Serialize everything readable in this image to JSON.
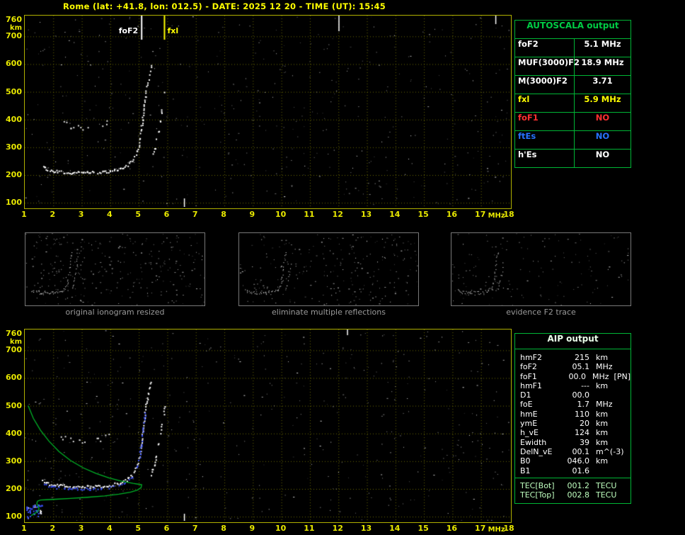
{
  "header": {
    "title": "Rome (lat: +41.8, lon: 012.5) - DATE: 2025 12 20 - TIME (UT): 15:45"
  },
  "axes": {
    "y_unit": "km",
    "x_unit": "MHz",
    "y_ticks": [
      "760",
      "700",
      "600",
      "500",
      "400",
      "300",
      "200",
      "100"
    ],
    "x_ticks": [
      "1",
      "2",
      "3",
      "4",
      "5",
      "6",
      "7",
      "8",
      "9",
      "10",
      "11",
      "12",
      "13",
      "14",
      "15",
      "16",
      "17",
      "18"
    ],
    "y_range_km": [
      100,
      760
    ],
    "x_range_mhz": [
      1,
      18
    ]
  },
  "top_plot": {
    "markers": [
      {
        "label": "foF2",
        "mhz": 5.1,
        "color": "#ffffff",
        "side": "left"
      },
      {
        "label": "fxl",
        "mhz": 5.9,
        "color": "#ffff00",
        "side": "right"
      }
    ]
  },
  "thumbnails": [
    {
      "caption": "original ionogram resized"
    },
    {
      "caption": "eliminate multiple reflections"
    },
    {
      "caption": "evidence F2 trace"
    }
  ],
  "autoscala_table": {
    "title": "AUTOSCALA output",
    "rows": [
      {
        "label": "foF2",
        "value": "5.1 MHz",
        "color": "#ffffff"
      },
      {
        "label": "MUF(3000)F2",
        "value": "18.9 MHz",
        "color": "#ffffff"
      },
      {
        "label": "M(3000)F2",
        "value": "3.71",
        "color": "#ffffff"
      },
      {
        "label": "fxl",
        "value": "5.9 MHz",
        "color": "#ffff00"
      },
      {
        "label": "foF1",
        "value": "NO",
        "color": "#ff3030"
      },
      {
        "label": "ftEs",
        "value": "NO",
        "color": "#2673ff"
      },
      {
        "label": "h'Es",
        "value": "NO",
        "color": "#ffffff"
      }
    ]
  },
  "aip_table": {
    "title": "AIP output",
    "rows": [
      {
        "label": "hmF2",
        "value": "215",
        "unit": "km",
        "note": ""
      },
      {
        "label": "foF2",
        "value": "05.1",
        "unit": "MHz",
        "note": ""
      },
      {
        "label": "foF1",
        "value": "00.0",
        "unit": "MHz",
        "note": "[PN]"
      },
      {
        "label": "hmF1",
        "value": "---",
        "unit": "km",
        "note": ""
      },
      {
        "label": "D1",
        "value": "00.0",
        "unit": "",
        "note": ""
      },
      {
        "label": "foE",
        "value": "1.7",
        "unit": "MHz",
        "note": ""
      },
      {
        "label": "hmE",
        "value": "110",
        "unit": "km",
        "note": ""
      },
      {
        "label": "ymE",
        "value": "20",
        "unit": "km",
        "note": ""
      },
      {
        "label": "h_vE",
        "value": "124",
        "unit": "km",
        "note": ""
      },
      {
        "label": "Ewidth",
        "value": "39",
        "unit": "km",
        "note": ""
      },
      {
        "label": "DelN_vE",
        "value": "00.1",
        "unit": "m^(-3)",
        "note": ""
      },
      {
        "label": "B0",
        "value": "046.0",
        "unit": "km",
        "note": ""
      },
      {
        "label": "B1",
        "value": "01.6",
        "unit": "",
        "note": ""
      }
    ],
    "tec_rows": [
      {
        "label": "TEC[Bot]",
        "value": "001.2",
        "unit": "TECU"
      },
      {
        "label": "TEC[Top]",
        "value": "002.8",
        "unit": "TECU"
      }
    ]
  },
  "colors": {
    "title_yellow": "#ffff00",
    "axis": "#e9e900",
    "grid": "#6b6b00",
    "plot_border": "#b0b000",
    "trace": "#ffffff",
    "profile_green": "#00b428",
    "trace_blue": "#3b52ff",
    "panel_green": "#00b535",
    "caption_gray": "#9a9a9a"
  }
}
